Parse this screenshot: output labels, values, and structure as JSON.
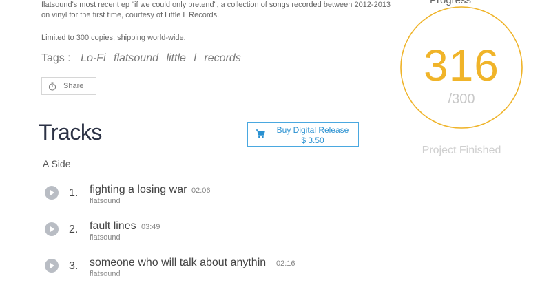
{
  "description": {
    "line1": "flatsound's most recent ep \"if we could only pretend\", a collection of songs recorded between 2012-2013",
    "line2": "on vinyl for the first time, courtesy of Little L Records.",
    "line3": "Limited to 300 copies, shipping world-wide."
  },
  "tags": {
    "label": "Tags :",
    "items": [
      "Lo-Fi",
      "flatsound",
      "little",
      "l",
      "records"
    ]
  },
  "share": {
    "label": "Share",
    "icon": "stopwatch-icon"
  },
  "tracks_heading": "Tracks",
  "buy": {
    "label": "Buy Digital Release",
    "price": "$ 3.50",
    "icon": "cart-icon",
    "color": "#2a91d1"
  },
  "side": {
    "label": "A Side"
  },
  "tracks": [
    {
      "number": "1.",
      "title": "fighting a losing war",
      "duration": "02:06",
      "artist": "flatsound"
    },
    {
      "number": "2.",
      "title": "fault lines",
      "duration": "03:49",
      "artist": "flatsound"
    },
    {
      "number": "3.",
      "title": "someone who will talk about anythin",
      "duration": "02:16",
      "artist": "flatsound"
    }
  ],
  "progress": {
    "label": "Progress",
    "count": "316",
    "goal": "/300",
    "status": "Project Finished",
    "ring_color": "#f0b429",
    "ring_fill_fraction": 1.0
  }
}
